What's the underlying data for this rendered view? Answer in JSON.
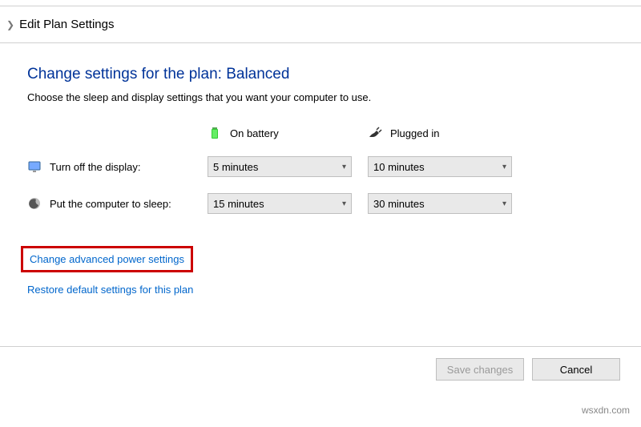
{
  "breadcrumb": "Edit Plan Settings",
  "heading": "Change settings for the plan: Balanced",
  "subtitle": "Choose the sleep and display settings that you want your computer to use.",
  "columns": {
    "battery": "On battery",
    "plugged": "Plugged in"
  },
  "rows": {
    "display": {
      "label": "Turn off the display:",
      "battery_value": "5 minutes",
      "plugged_value": "10 minutes"
    },
    "sleep": {
      "label": "Put the computer to sleep:",
      "battery_value": "15 minutes",
      "plugged_value": "30 minutes"
    }
  },
  "links": {
    "advanced": "Change advanced power settings",
    "restore": "Restore default settings for this plan"
  },
  "buttons": {
    "save": "Save changes",
    "cancel": "Cancel"
  },
  "watermark": "wsxdn.com"
}
